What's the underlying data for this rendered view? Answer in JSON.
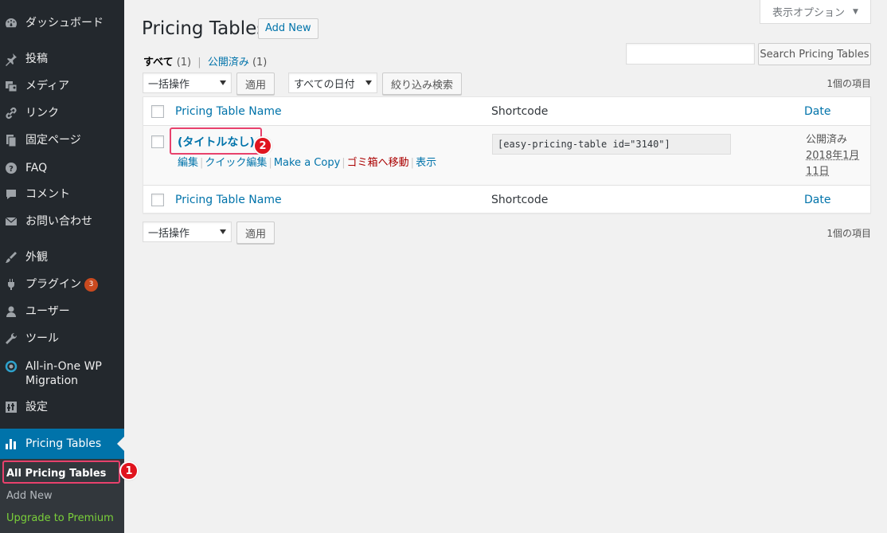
{
  "sidebar": {
    "items": [
      {
        "label": "ダッシュボード",
        "icon": "dashboard-icon"
      },
      {
        "label": "投稿",
        "icon": "pin-icon"
      },
      {
        "label": "メディア",
        "icon": "media-icon"
      },
      {
        "label": "リンク",
        "icon": "link-icon"
      },
      {
        "label": "固定ページ",
        "icon": "page-icon"
      },
      {
        "label": "FAQ",
        "icon": "help-icon"
      },
      {
        "label": "コメント",
        "icon": "comment-icon"
      },
      {
        "label": "お問い合わせ",
        "icon": "mail-icon"
      },
      {
        "label": "外観",
        "icon": "brush-icon"
      },
      {
        "label": "プラグイン",
        "icon": "plugin-icon",
        "badge": "3"
      },
      {
        "label": "ユーザー",
        "icon": "user-icon"
      },
      {
        "label": "ツール",
        "icon": "wrench-icon"
      },
      {
        "label": "All-in-One WP Migration",
        "icon": "migration-icon"
      },
      {
        "label": "設定",
        "icon": "settings-icon"
      }
    ],
    "active": {
      "label": "Pricing Tables",
      "icon": "bar-chart-icon"
    },
    "submenu": [
      {
        "label": "All Pricing Tables"
      },
      {
        "label": "Add New"
      },
      {
        "label": "Upgrade to Premium"
      }
    ]
  },
  "callouts": {
    "one": "1",
    "two": "2"
  },
  "screen_options": {
    "label": "表示オプション"
  },
  "header": {
    "title": "Pricing Tables",
    "add_new": "Add New"
  },
  "filters": {
    "all_label": "すべて",
    "all_count": "(1)",
    "separator": "|",
    "published_label": "公開済み",
    "published_count": "(1)"
  },
  "search": {
    "button": "Search Pricing Tables",
    "value": ""
  },
  "toolbar_top": {
    "bulk_select": "一括操作",
    "apply": "適用",
    "date_select": "すべての日付",
    "filter_btn": "絞り込み検索",
    "items_count": "1個の項目"
  },
  "table": {
    "columns": [
      "Pricing Table Name",
      "Shortcode",
      "Date"
    ],
    "rows": [
      {
        "title": "(タイトルなし)",
        "actions": [
          "編集",
          "クイック編集",
          "Make a Copy",
          "ゴミ箱へ移動",
          "表示"
        ],
        "shortcode": "[easy-pricing-table id=\"3140\"]",
        "date_status": "公開済み",
        "date_line1": "2018年1月",
        "date_line2": "11日"
      }
    ]
  },
  "toolbar_bottom": {
    "bulk_select": "一括操作",
    "apply": "適用",
    "items_count": "1個の項目"
  },
  "colors": {
    "sidebar_bg": "#23282d",
    "active_bg": "#0073aa",
    "link": "#0073aa",
    "trash": "#aa0000",
    "callout": "#e0141e",
    "highlight": "#e8416c",
    "badge": "#ca4a1f",
    "premium": "#7ad03a"
  }
}
